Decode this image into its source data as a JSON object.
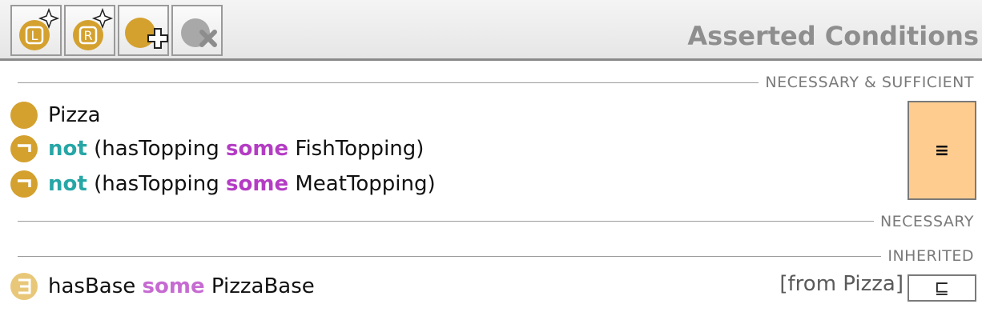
{
  "panel": {
    "title": "Asserted Conditions"
  },
  "toolbar": {
    "buttons": [
      {
        "name": "create-necessary-sufficient",
        "glyph": "L",
        "color": "#d9a62a"
      },
      {
        "name": "create-restriction",
        "glyph": "R",
        "color": "#d9a62a"
      },
      {
        "name": "add-named-class",
        "color": "#d9a62a"
      },
      {
        "name": "delete-condition",
        "color": "#9a9a9a",
        "disabled": true
      }
    ]
  },
  "sections": {
    "necessary_sufficient": "NECESSARY & SUFFICIENT",
    "necessary": "NECESSARY",
    "inherited": "INHERITED"
  },
  "conditions": [
    {
      "icon": "named-class",
      "text": "Pizza"
    },
    {
      "icon": "negation",
      "not": "not",
      "open": " (hasTopping ",
      "some": "some",
      "rest": " FishTopping)"
    },
    {
      "icon": "negation",
      "not": "not",
      "open": " (hasTopping ",
      "some": "some",
      "rest": " MeatTopping)"
    }
  ],
  "equivalent_symbol": "≡",
  "inherited": [
    {
      "icon": "exists",
      "prop": "hasBase ",
      "some": "some",
      "rest": " PizzaBase",
      "from": "[from Pizza]",
      "symbol": "⊑"
    }
  ],
  "colors": {
    "class_gold": "#d4a12f",
    "keyword_not": "#27a6a6",
    "keyword_some": "#b43cc4",
    "equiv_box": "#ffcc8f"
  }
}
